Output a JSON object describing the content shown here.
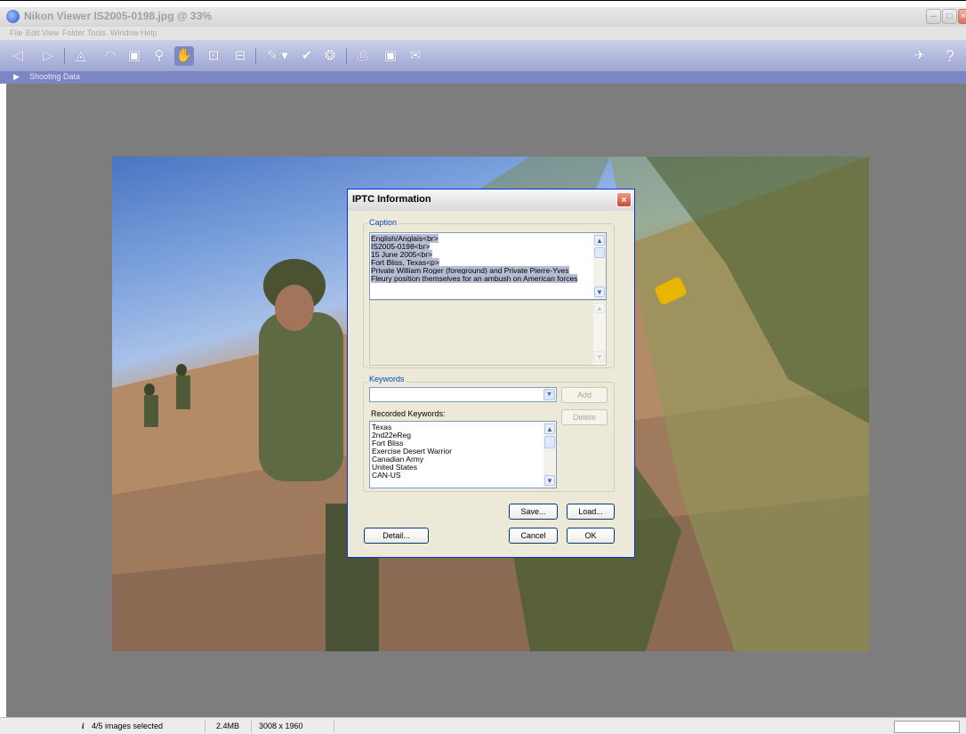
{
  "window": {
    "title": "Nikon Viewer IS2005-0198.jpg @ 33%",
    "controls": {
      "minimize": "–",
      "maximize": "□",
      "close": "×"
    }
  },
  "menu": [
    "File",
    "Edit",
    "View",
    "Folder",
    "Tools",
    "Window",
    "Help"
  ],
  "toolbar": {
    "icons": {
      "prev": "◁",
      "next": "▷",
      "rotate_left": "◬",
      "rotate_right": "◠",
      "slideshow": "▣",
      "zoom": "⚲",
      "hand": "✋",
      "fit": "⊡",
      "actual_size": "⊟",
      "edit": "✎",
      "edit_menu": "▾",
      "check": "✔",
      "protect": "❂",
      "print": "⎙",
      "monitor": "▣",
      "mail": "✉",
      "tools": "✈",
      "help": "?"
    }
  },
  "shooting_data": {
    "label": "Shooting Data",
    "arrow": "▶"
  },
  "dialog": {
    "title": "IPTC Information",
    "caption": {
      "legend": "Caption",
      "lines": [
        "English/Anglais<br>",
        "IS2005-0198<br>",
        "15 June 2005<br>",
        "Fort Bliss, Texas<p>",
        "Private William Roger (foreground) and Private Pierre-Yves",
        "Fleury position themselves for an ambush on American forces"
      ]
    },
    "keywords": {
      "legend": "Keywords",
      "input_value": "",
      "add_label": "Add",
      "delete_label": "Delete",
      "recorded_label": "Recorded Keywords:",
      "recorded": [
        "Texas",
        "2nd22eReg",
        "Fort Bliss",
        "Exercise Desert Warrior",
        "Canadian Army",
        "United States",
        "CAN-US"
      ]
    },
    "buttons": {
      "save": "Save...",
      "load": "Load...",
      "detail": "Detail...",
      "cancel": "Cancel",
      "ok": "OK"
    },
    "close_glyph": "×",
    "scroll_glyphs": {
      "up": "▲",
      "down": "▼",
      "combo": "▼"
    }
  },
  "status": {
    "info_icon": "i",
    "selection": "4/5 images selected",
    "size": "2.4MB",
    "dimensions": "3008 x 1960"
  },
  "colors": {
    "toolbar": "#9ea6d3",
    "shooting_bar": "#7c86c2",
    "viewer_bg": "#7d7d7d",
    "dialog_bg": "#ece9d8"
  }
}
